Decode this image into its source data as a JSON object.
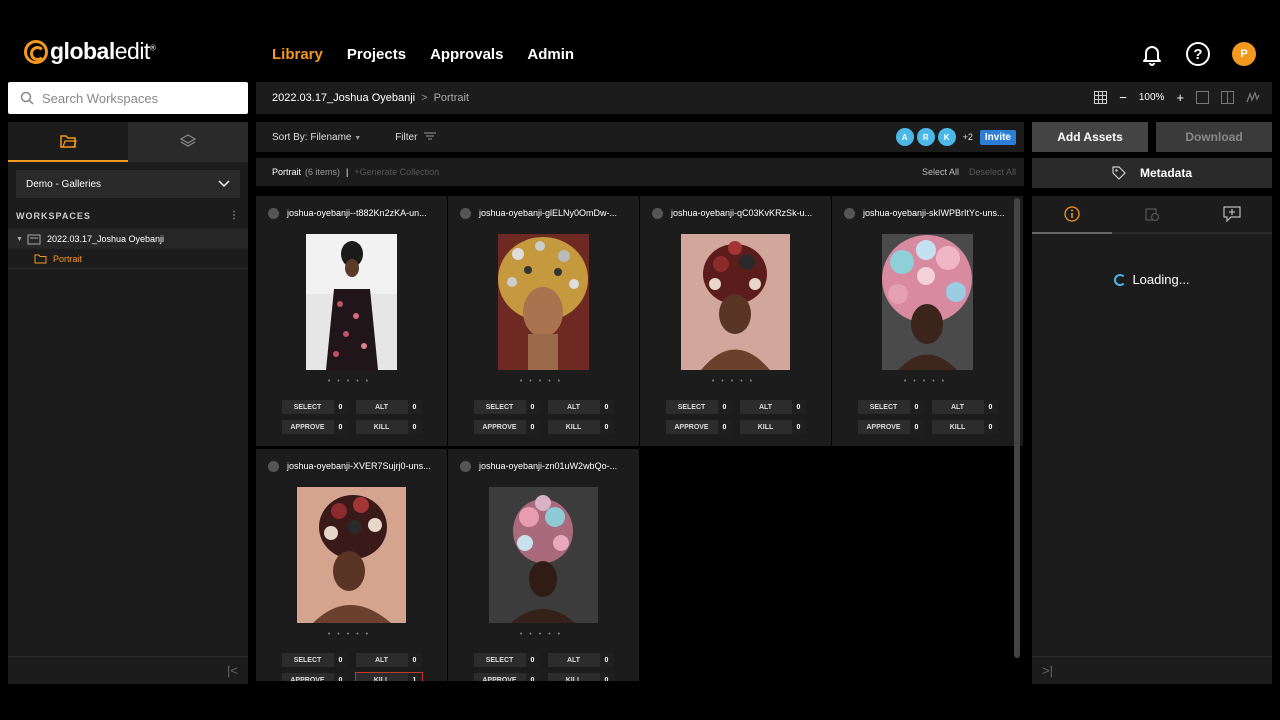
{
  "brand": {
    "name_bold": "global",
    "name_light": "edit",
    "mark": "®"
  },
  "nav": [
    {
      "label": "Library",
      "active": true
    },
    {
      "label": "Projects",
      "active": false
    },
    {
      "label": "Approvals",
      "active": false
    },
    {
      "label": "Admin",
      "active": false
    }
  ],
  "user": {
    "initial": "P",
    "help": "?"
  },
  "search": {
    "placeholder": "Search Workspaces"
  },
  "sidebar": {
    "dropdown_value": "Demo - Galleries",
    "workspaces_heading": "WORKSPACES",
    "workspace": "2022.03.17_Joshua Oyebanji",
    "folder": "Portrait"
  },
  "breadcrumb": {
    "workspace": "2022.03.17_Joshua Oyebanji",
    "separator": ">",
    "current": "Portrait"
  },
  "view": {
    "zoom": "100%",
    "minus": "−",
    "plus": "+"
  },
  "toolbar": {
    "sort_label": "Sort By: Filename",
    "filter_label": "Filter",
    "collaborators": [
      "A",
      "R",
      "K"
    ],
    "more_collaborators": "+2",
    "invite_label": "Invite"
  },
  "collection": {
    "name": "Portrait",
    "count": "(6 items)",
    "generate": "+Generate Collection",
    "select_all": "Select All",
    "deselect_all": "Deselect All"
  },
  "assets": [
    {
      "filename": "joshua-oyebanji--t882Kn2zKA-un...",
      "select": "0",
      "alt": "0",
      "approve": "0",
      "kill": "0"
    },
    {
      "filename": "joshua-oyebanji-glELNy0OmDw-...",
      "select": "0",
      "alt": "0",
      "approve": "0",
      "kill": "0"
    },
    {
      "filename": "joshua-oyebanji-qC03KvKRzSk-u...",
      "select": "0",
      "alt": "0",
      "approve": "0",
      "kill": "0"
    },
    {
      "filename": "joshua-oyebanji-skIWPBrItYc-uns...",
      "select": "0",
      "alt": "0",
      "approve": "0",
      "kill": "0"
    },
    {
      "filename": "joshua-oyebanji-XVER7Sujrj0-uns...",
      "select": "0",
      "alt": "0",
      "approve": "0",
      "kill": "1"
    },
    {
      "filename": "joshua-oyebanji-zn01uW2wbQo-...",
      "select": "0",
      "alt": "0",
      "approve": "0",
      "kill": "0"
    }
  ],
  "buttons": {
    "select": "SELECT",
    "alt": "ALT",
    "approve": "APPROVE",
    "kill": "KILL"
  },
  "actions": {
    "add_assets": "Add Assets",
    "download": "Download",
    "metadata": "Metadata"
  },
  "right_panel": {
    "loading": "Loading..."
  },
  "colors": {
    "accent": "#f39a1e",
    "invite": "#2d7fd6",
    "collaborator": "#4db8e8"
  }
}
